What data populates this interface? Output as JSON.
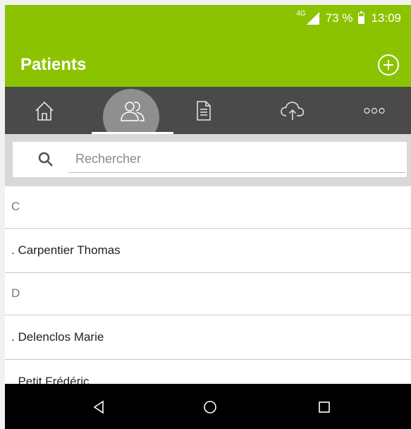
{
  "status": {
    "network": "4G",
    "battery_pct": "73 %",
    "time": "13:09",
    "icons": [
      "signal-icon",
      "battery-icon"
    ]
  },
  "appbar": {
    "title": "Patients",
    "add_icon": "add-circle-icon"
  },
  "tabs": [
    {
      "name": "home",
      "icon": "home-icon"
    },
    {
      "name": "patients",
      "icon": "patients-icon",
      "active": true
    },
    {
      "name": "documents",
      "icon": "document-icon"
    },
    {
      "name": "cloud",
      "icon": "cloud-upload-icon"
    },
    {
      "name": "more",
      "icon": "more-icon"
    }
  ],
  "search": {
    "placeholder": "Rechercher",
    "value": ""
  },
  "list": [
    {
      "type": "header",
      "label": "C"
    },
    {
      "type": "patient",
      "label": ". Carpentier Thomas"
    },
    {
      "type": "header",
      "label": "D"
    },
    {
      "type": "patient",
      "label": ". Delenclos Marie"
    },
    {
      "type": "patient",
      "label": ". Petit Frédéric"
    }
  ],
  "colors": {
    "accent": "#8cc300",
    "tabbar": "#4a4a4a",
    "active_tab_bubble": "#8f8f8f",
    "navbar": "#000000"
  }
}
